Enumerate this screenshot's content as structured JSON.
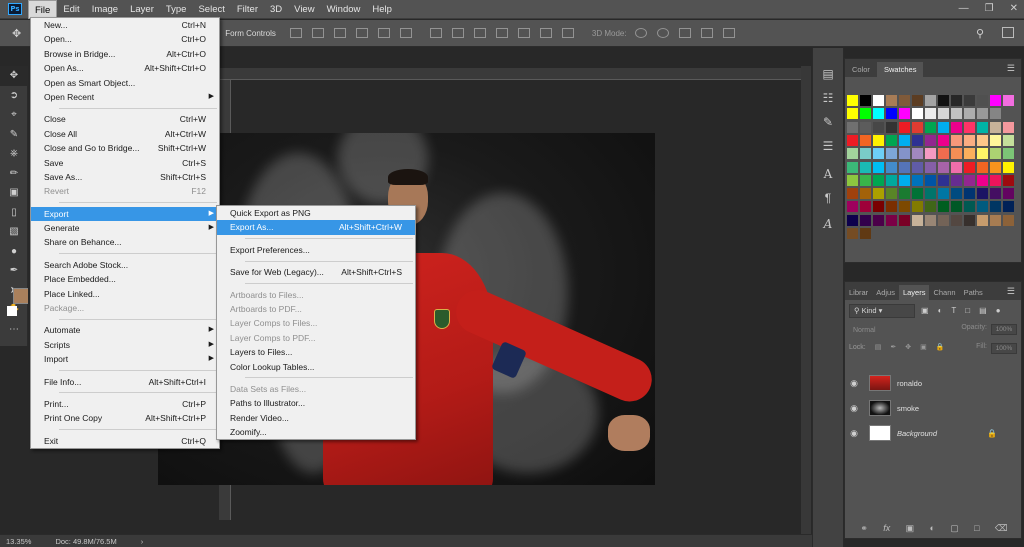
{
  "menubar": {
    "app_logo": "Ps",
    "items": [
      "File",
      "Edit",
      "Image",
      "Layer",
      "Type",
      "Select",
      "Filter",
      "3D",
      "View",
      "Window",
      "Help"
    ],
    "active_index": 0
  },
  "options_bar": {
    "form_controls_label": "Form Controls",
    "mode_label": "3D Mode:"
  },
  "file_menu": [
    {
      "label": "New...",
      "shortcut": "Ctrl+N"
    },
    {
      "label": "Open...",
      "shortcut": "Ctrl+O"
    },
    {
      "label": "Browse in Bridge...",
      "shortcut": "Alt+Ctrl+O"
    },
    {
      "label": "Open As...",
      "shortcut": "Alt+Shift+Ctrl+O"
    },
    {
      "label": "Open as Smart Object...",
      "shortcut": ""
    },
    {
      "label": "Open Recent",
      "shortcut": "",
      "submenu": true
    },
    {
      "sep": true
    },
    {
      "label": "Close",
      "shortcut": "Ctrl+W"
    },
    {
      "label": "Close All",
      "shortcut": "Alt+Ctrl+W"
    },
    {
      "label": "Close and Go to Bridge...",
      "shortcut": "Shift+Ctrl+W"
    },
    {
      "label": "Save",
      "shortcut": "Ctrl+S"
    },
    {
      "label": "Save As...",
      "shortcut": "Shift+Ctrl+S"
    },
    {
      "label": "Revert",
      "shortcut": "F12",
      "disabled": true
    },
    {
      "sep": true
    },
    {
      "label": "Export",
      "shortcut": "",
      "submenu": true,
      "highlight": true
    },
    {
      "label": "Generate",
      "shortcut": "",
      "submenu": true
    },
    {
      "label": "Share on Behance...",
      "shortcut": ""
    },
    {
      "sep": true
    },
    {
      "label": "Search Adobe Stock...",
      "shortcut": ""
    },
    {
      "label": "Place Embedded...",
      "shortcut": ""
    },
    {
      "label": "Place Linked...",
      "shortcut": ""
    },
    {
      "label": "Package...",
      "shortcut": "",
      "disabled": true
    },
    {
      "sep": true
    },
    {
      "label": "Automate",
      "shortcut": "",
      "submenu": true
    },
    {
      "label": "Scripts",
      "shortcut": "",
      "submenu": true
    },
    {
      "label": "Import",
      "shortcut": "",
      "submenu": true
    },
    {
      "sep": true
    },
    {
      "label": "File Info...",
      "shortcut": "Alt+Shift+Ctrl+I"
    },
    {
      "sep": true
    },
    {
      "label": "Print...",
      "shortcut": "Ctrl+P"
    },
    {
      "label": "Print One Copy",
      "shortcut": "Alt+Shift+Ctrl+P"
    },
    {
      "sep": true
    },
    {
      "label": "Exit",
      "shortcut": "Ctrl+Q"
    }
  ],
  "export_submenu": [
    {
      "label": "Quick Export as PNG",
      "shortcut": ""
    },
    {
      "label": "Export As...",
      "shortcut": "Alt+Shift+Ctrl+W",
      "highlight": true
    },
    {
      "sep": true
    },
    {
      "label": "Export Preferences...",
      "shortcut": ""
    },
    {
      "sep": true
    },
    {
      "label": "Save for Web (Legacy)...",
      "shortcut": "Alt+Shift+Ctrl+S"
    },
    {
      "sep": true
    },
    {
      "label": "Artboards to Files...",
      "shortcut": "",
      "disabled": true
    },
    {
      "label": "Artboards to PDF...",
      "shortcut": "",
      "disabled": true
    },
    {
      "label": "Layer Comps to Files...",
      "shortcut": "",
      "disabled": true
    },
    {
      "label": "Layer Comps to PDF...",
      "shortcut": "",
      "disabled": true
    },
    {
      "label": "Layers to Files...",
      "shortcut": ""
    },
    {
      "label": "Color Lookup Tables...",
      "shortcut": ""
    },
    {
      "sep": true
    },
    {
      "label": "Data Sets as Files...",
      "shortcut": "",
      "disabled": true
    },
    {
      "label": "Paths to Illustrator...",
      "shortcut": ""
    },
    {
      "label": "Render Video...",
      "shortcut": ""
    },
    {
      "label": "Zoomify...",
      "shortcut": ""
    }
  ],
  "swatches_panel": {
    "tabs": [
      "Color",
      "Swatches"
    ],
    "active_tab": "Swatches",
    "rows": [
      [
        "#ffff00",
        "#000000",
        "#ffffff",
        "#a77c56",
        "#7f5a3a",
        "#5c3d22",
        "#a4a4a4",
        "#121212",
        "#272727",
        "#3a3a3a",
        "#505050",
        "#ff00ff",
        "#f36de0"
      ],
      [
        "#ffff00",
        "#00ff00",
        "#00ffff",
        "#0000ff",
        "#ff00ff",
        "#ffffff",
        "#ebebeb",
        "#d6d6d6",
        "#c2c2c2",
        "#adadad",
        "#999999",
        "#858585"
      ],
      [
        "#707070",
        "#5c5c5c",
        "#474747",
        "#333333",
        "#ed1c24",
        "#e03c31",
        "#00a651",
        "#00aeef",
        "#ec008c",
        "#ff3366",
        "#00b3a6",
        "#c7b299",
        "#f5989d"
      ],
      [
        "#ed1c24",
        "#f26522",
        "#fff200",
        "#00a651",
        "#00aeef",
        "#2e3192",
        "#92278f",
        "#ec008c",
        "#f7977a",
        "#fbad82",
        "#fdc689",
        "#fff79a",
        "#c4df9b"
      ],
      [
        "#a3d39c",
        "#7accc8",
        "#6dcff6",
        "#7da7d8",
        "#8493ca",
        "#a187be",
        "#f49ac2",
        "#f26c4f",
        "#f68e55",
        "#fbaf5c",
        "#fff467",
        "#acd372",
        "#7cc576"
      ],
      [
        "#3bb878",
        "#1abbb4",
        "#00bff3",
        "#438ccb",
        "#5574b9",
        "#605ca8",
        "#855fa8",
        "#a763a8",
        "#f06eaa",
        "#ed1c24",
        "#f26522",
        "#f7941d",
        "#fff200"
      ],
      [
        "#8dc63f",
        "#39b54a",
        "#00a651",
        "#00a99d",
        "#00aeef",
        "#0072bc",
        "#0054a6",
        "#2e3192",
        "#662d91",
        "#92278f",
        "#ec008c",
        "#ed145b",
        "#9e0b0f"
      ],
      [
        "#a0410d",
        "#a36209",
        "#aba000",
        "#598527",
        "#1a7b30",
        "#007236",
        "#00746b",
        "#0076a3",
        "#004b80",
        "#003471",
        "#1b1464",
        "#440e62",
        "#630460"
      ],
      [
        "#9e005d",
        "#9e0039",
        "#790000",
        "#7b2e00",
        "#7d4900",
        "#827b00",
        "#406618",
        "#005e20",
        "#005826",
        "#005952",
        "#005b7f",
        "#003663",
        "#002157"
      ],
      [
        "#0d004c",
        "#32004b",
        "#4b0049",
        "#7b0046",
        "#7a0026",
        "#c7b299",
        "#998675",
        "#736357",
        "#534741",
        "#37302d",
        "#c69c6d",
        "#a67c52",
        "#8c6239"
      ],
      [
        "#754c24",
        "#603913"
      ]
    ]
  },
  "layers_panel": {
    "tabs": [
      "Librar",
      "Adjus",
      "Layers",
      "Chann",
      "Paths"
    ],
    "active_tab": "Layers",
    "filter_kind": "Kind",
    "blend_mode": "Normal",
    "opacity_label": "Opacity:",
    "opacity_value": "100%",
    "lock_label": "Lock:",
    "fill_label": "Fill:",
    "fill_value": "100%",
    "layers": [
      {
        "name": "ronaldo",
        "italic": false,
        "locked": false
      },
      {
        "name": "smoke",
        "italic": false,
        "locked": false
      },
      {
        "name": "Background",
        "italic": true,
        "locked": true
      }
    ]
  },
  "statusbar": {
    "zoom": "13.35%",
    "doc_info": "Doc: 49.8M/76.5M"
  },
  "colors": {
    "foreground": "#a9805c",
    "background": "#ffffff",
    "highlight": "#3796e6"
  }
}
